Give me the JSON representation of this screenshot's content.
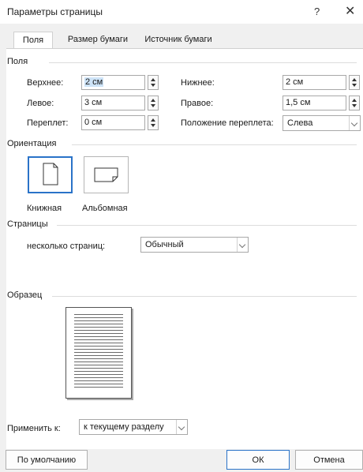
{
  "window": {
    "title": "Параметры страницы",
    "help_label": "?",
    "close_label": "✕"
  },
  "tabs": [
    {
      "label": "Поля",
      "active": true
    },
    {
      "label": "Размер бумаги",
      "active": false
    },
    {
      "label": "Источник бумаги",
      "active": false
    }
  ],
  "margins": {
    "group_label": "Поля",
    "top_label": "Верхнее:",
    "top_value": "2 см",
    "bottom_label": "Нижнее:",
    "bottom_value": "2 см",
    "left_label": "Левое:",
    "left_value": "3 см",
    "right_label": "Правое:",
    "right_value": "1,5 см",
    "gutter_label": "Переплет:",
    "gutter_value": "0 см",
    "gutter_pos_label": "Положение переплета:",
    "gutter_pos_value": "Слева"
  },
  "orientation": {
    "group_label": "Ориентация",
    "portrait_label": "Книжная",
    "landscape_label": "Альбомная",
    "selected": "portrait"
  },
  "pages": {
    "group_label": "Страницы",
    "multiple_label": "несколько страниц:",
    "multiple_value": "Обычный"
  },
  "preview": {
    "group_label": "Образец",
    "apply_label": "Применить к:",
    "apply_value": "к текущему разделу"
  },
  "footer": {
    "default_label": "По умолчанию",
    "ok_label": "ОК",
    "cancel_label": "Отмена"
  },
  "colors": {
    "accent": "#2a73c8",
    "selection": "#cde3f7"
  }
}
